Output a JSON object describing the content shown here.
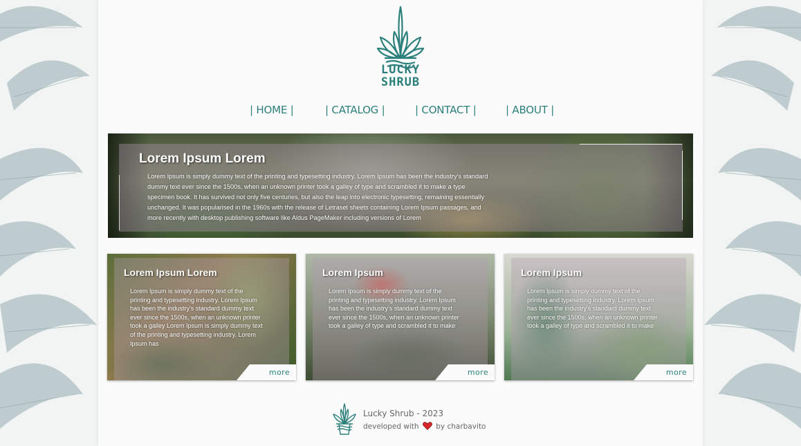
{
  "brand": {
    "name_line1": "LUCKY",
    "name_line2": "SHRUB",
    "accent_color": "#2a7f7b",
    "logo_icon": "potted-plant-logo-icon"
  },
  "nav": {
    "items": [
      {
        "label": "| HOME |"
      },
      {
        "label": "| CATALOG |"
      },
      {
        "label": "| CONTACT |"
      },
      {
        "label": "| ABOUT |"
      }
    ]
  },
  "hero": {
    "title": "Lorem Ipsum Lorem",
    "body": "Lorem Ipsum is simply dummy text of the printing and typesetting industry. Lorem Ipsum has been the industry's standard dummy text ever since the 1500s, when an unknown printer took a galley of type and scrambled it to make a type specimen book. It has survived not only five centuries, but also the leap into electronic typesetting, remaining essentially unchanged. It was popularised in the 1960s with the release of Letraset sheets containing Lorem Ipsum passages, and more recently with desktop publishing software like Aldus PageMaker including versions of Lorem"
  },
  "cards": [
    {
      "title": "Lorem Ipsum Lorem",
      "body": "Lorem Ipsum is simply dummy text of the printing and typesetting industry. Lorem Ipsum has been the industry's standard dummy text ever since the 1500s, when an unknown printer took a galley  Lorem Ipsum is simply dummy text of the printing and typesetting industry. Lorem Ipsum has",
      "more_label": "more"
    },
    {
      "title": "Lorem Ipsum",
      "body": "Lorem Ipsum is simply dummy text of the printing and typesetting industry. Lorem Ipsum has been the industry's standard dummy text ever since the 1500s, when an unknown printer took a galley of type and scrambled it to make",
      "more_label": "more"
    },
    {
      "title": "Lorem Ipsum",
      "body": "Lorem Ipsum is simply dummy text of the printing and typesetting industry. Lorem Ipsum has been the industry's standard dummy text ever since the 1500s, when an unknown printer took a galley of type and scrambled it to make",
      "more_label": "more"
    }
  ],
  "footer": {
    "title": "Lucky Shrub - 2023",
    "developed_prefix": "developed with",
    "developed_suffix": "by charbavito",
    "heart_icon": "heart-icon",
    "heart_color": "#d9262c"
  }
}
